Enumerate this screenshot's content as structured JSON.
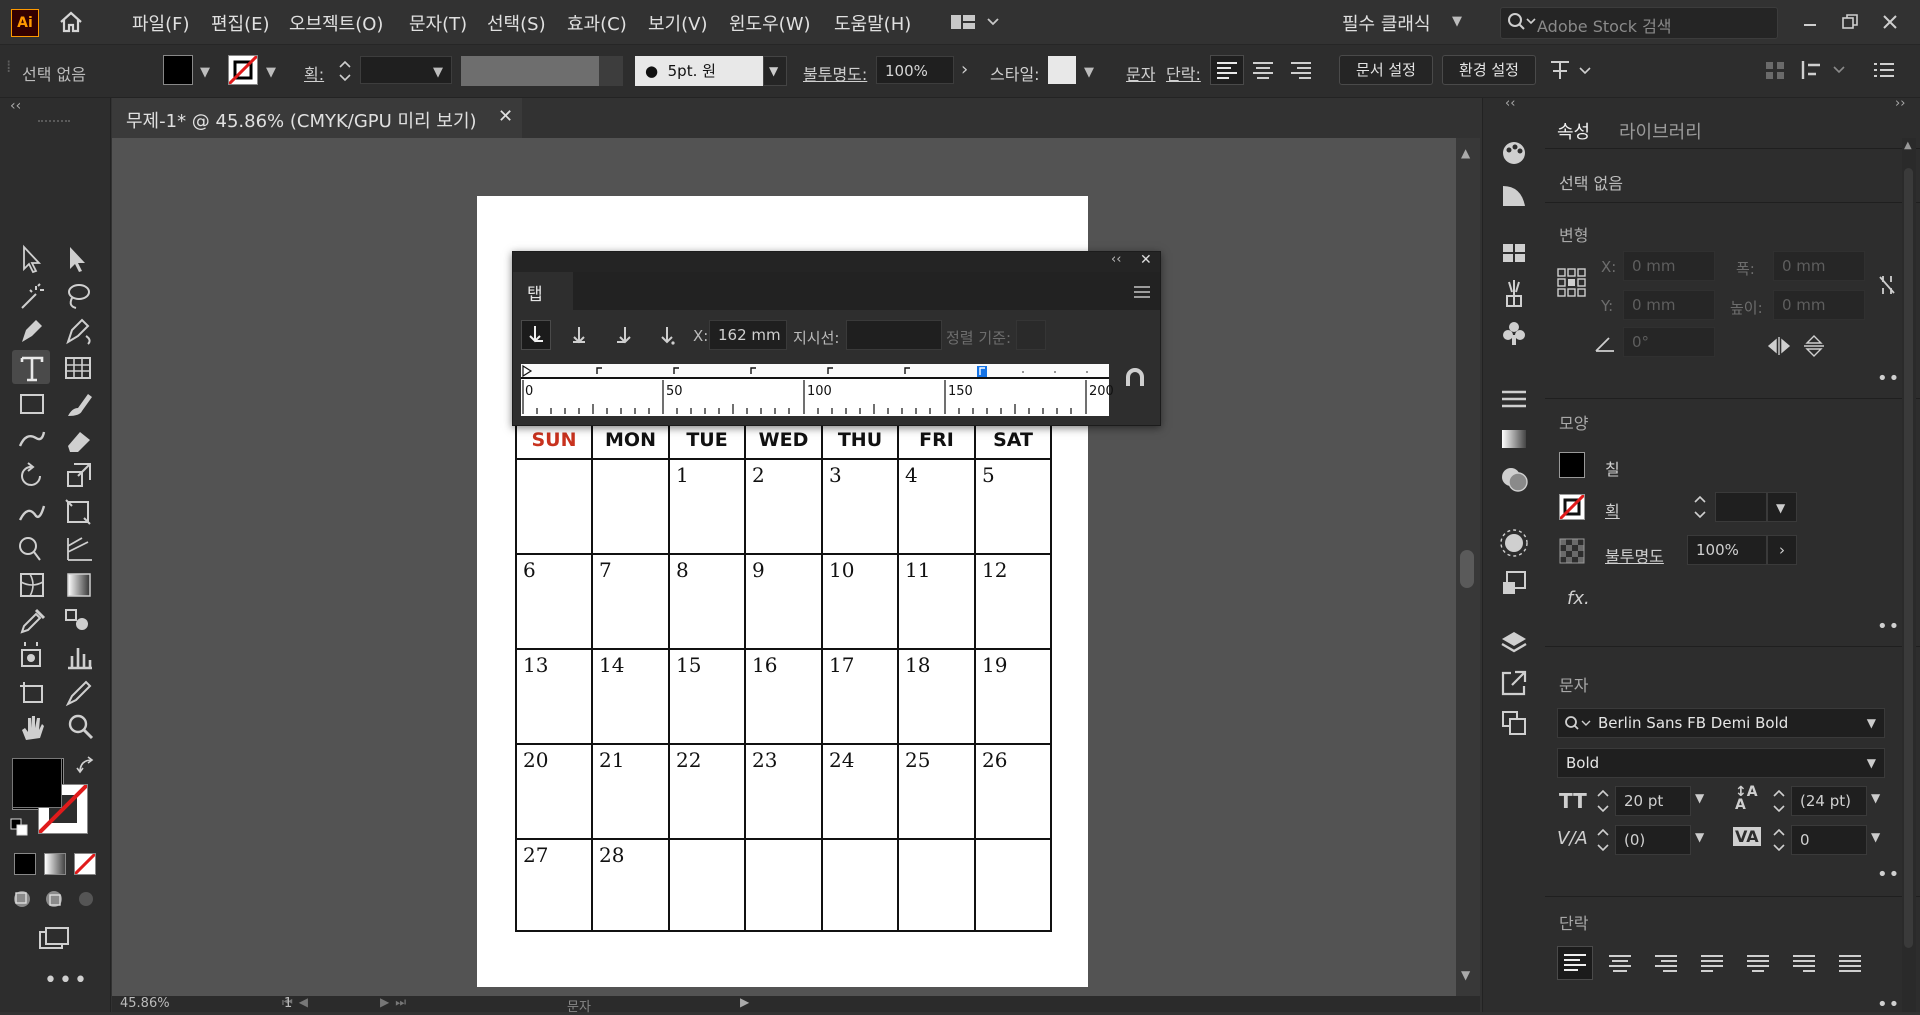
{
  "app": {
    "logo": "Ai",
    "workspace": "필수 클래식",
    "search_placeholder": "Adobe Stock 검색"
  },
  "menu": [
    "파일(F)",
    "편집(E)",
    "오브젝트(O)",
    "문자(T)",
    "선택(S)",
    "효과(C)",
    "보기(V)",
    "윈도우(W)",
    "도움말(H)"
  ],
  "control": {
    "selection": "선택 없음",
    "stroke_label": "획:",
    "brush": "5pt. 원",
    "opacity_label": "불투명도:",
    "opacity": "100%",
    "style_label": "스타일:",
    "char_label": "문자",
    "para_label": "단락:",
    "doc_setup": "문서 설정",
    "prefs": "환경 설정"
  },
  "document": {
    "tab_title": "무제-1* @ 45.86% (CMYK/GPU 미리 보기)"
  },
  "calendar": {
    "days": [
      "SUN",
      "MON",
      "TUE",
      "WED",
      "THU",
      "FRI",
      "SAT"
    ],
    "sun_color": "#c8321e",
    "weeks": [
      [
        "",
        "",
        "1",
        "2",
        "3",
        "4",
        "5"
      ],
      [
        "6",
        "7",
        "8",
        "9",
        "10",
        "11",
        "12"
      ],
      [
        "13",
        "14",
        "15",
        "16",
        "17",
        "18",
        "19"
      ],
      [
        "20",
        "21",
        "22",
        "23",
        "24",
        "25",
        "26"
      ],
      [
        "27",
        "28",
        "",
        "",
        "",
        "",
        ""
      ]
    ]
  },
  "tabs_panel": {
    "title": "탭",
    "x_label": "X:",
    "x_value": "162 mm",
    "leader_label": "지시선:",
    "align_label": "정렬 기준:",
    "ruler_labels": [
      "0",
      "50",
      "100",
      "150",
      "200"
    ]
  },
  "status": {
    "zoom": "45.86%",
    "artboard": "1",
    "tool": "문자"
  },
  "properties": {
    "tabs": [
      "속성",
      "라이브러리"
    ],
    "no_selection": "선택 없음",
    "transform": {
      "title": "변형",
      "x_label": "X:",
      "x": "0 mm",
      "y_label": "Y:",
      "y": "0 mm",
      "w_label": "폭:",
      "w": "0 mm",
      "h_label": "높이:",
      "h": "0 mm",
      "angle": "0°"
    },
    "appearance": {
      "title": "모양",
      "fill": "칠",
      "stroke": "획",
      "opacity_label": "불투명도",
      "opacity": "100%"
    },
    "character": {
      "title": "문자",
      "font": "Berlin Sans FB Demi Bold",
      "style": "Bold",
      "size": "20 pt",
      "leading": "(24 pt)",
      "kerning": "(0)",
      "tracking": "0"
    },
    "paragraph": {
      "title": "단락"
    }
  },
  "colors": {
    "accent": "#1473e6",
    "ai_orange": "#ff9a00",
    "ui_bg": "#323232",
    "canvas": "#535353"
  }
}
